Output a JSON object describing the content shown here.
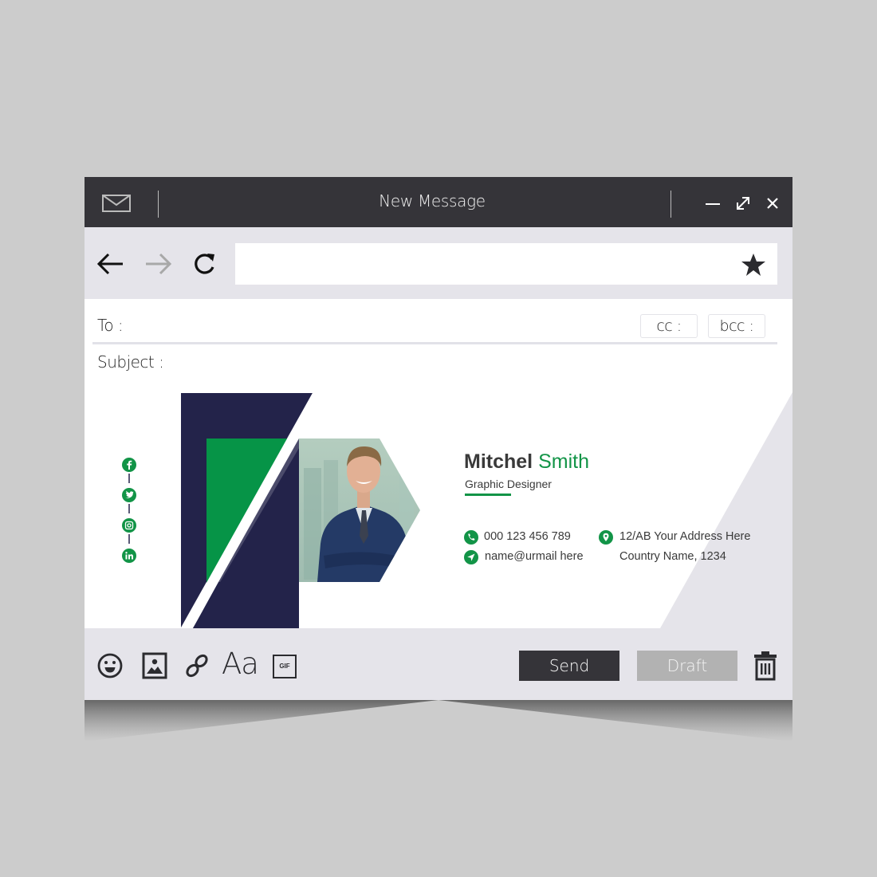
{
  "window": {
    "title": "New Message",
    "icons": {
      "app": "mail-icon",
      "minimize": "minimize-icon",
      "maximize": "expand-icon",
      "close": "close-icon"
    }
  },
  "nav": {
    "back": "arrow-left-icon",
    "forward": "arrow-right-icon",
    "reload": "reload-icon",
    "url_value": "",
    "bookmark": "star-icon"
  },
  "compose": {
    "to_label": "To :",
    "cc_label": "cc :",
    "bcc_label": "bcc :",
    "subject_label": "Subject :",
    "to_value": "",
    "subject_value": ""
  },
  "signature": {
    "first_name": "Mitchel",
    "last_name": "Smith",
    "role": "Graphic Designer",
    "phone": "000 123 456 789",
    "email": "name@urmail here",
    "address_line1": "12/AB Your Address Here",
    "address_line2": "Country Name, 1234",
    "social": [
      "facebook-icon",
      "twitter-icon",
      "instagram-icon",
      "linkedin-icon"
    ],
    "colors": {
      "green": "#129447",
      "navy": "#23234a",
      "text": "#3a3a3a",
      "gray_shape": "#e5e4ea"
    }
  },
  "footer": {
    "tools": [
      "emoji-icon",
      "image-icon",
      "link-icon",
      "font-icon",
      "gif-icon"
    ],
    "font_label": "Aa",
    "gif_label": "GIF",
    "send_label": "Send",
    "draft_label": "Draft",
    "delete": "trash-icon"
  },
  "colors": {
    "background": "#cccccc",
    "titlebar": "#353439",
    "toolbar": "#e5e4ea",
    "send_button": "#353439",
    "draft_button": "#b2b2b2"
  }
}
